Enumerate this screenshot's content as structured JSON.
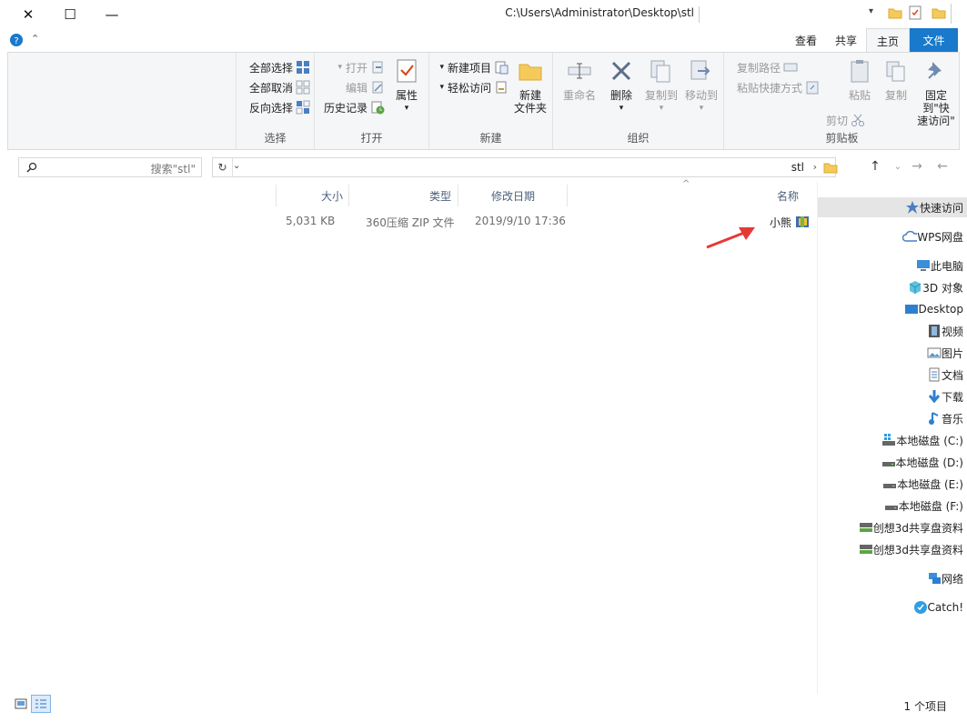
{
  "window": {
    "title": "C:\\Users\\Administrator\\Desktop\\stl",
    "minimize_glyph": "—",
    "maximize_glyph": "☐",
    "close_glyph": "✕"
  },
  "tabs": {
    "file": "文件",
    "home": "主页",
    "share": "共享",
    "view": "查看"
  },
  "ribbon": {
    "clipboard": {
      "label": "剪贴板",
      "pin_line1": "固定到\"快",
      "pin_line2": "速访问\"",
      "copy": "复制",
      "paste": "粘贴",
      "cut": "剪切",
      "copy_path": "复制路径",
      "paste_shortcut": "粘贴快捷方式"
    },
    "organize": {
      "label": "组织",
      "move_to": "移动到",
      "copy_to": "复制到",
      "delete": "删除",
      "rename": "重命名"
    },
    "new": {
      "label": "新建",
      "new_folder_line1": "新建",
      "new_folder_line2": "文件夹",
      "new_item": "新建项目",
      "easy_access": "轻松访问"
    },
    "open": {
      "label": "打开",
      "properties": "属性",
      "open": "打开",
      "edit": "编辑",
      "history": "历史记录"
    },
    "select": {
      "label": "选择",
      "select_all": "全部选择",
      "select_none": "全部取消",
      "invert": "反向选择"
    }
  },
  "address": {
    "path": "stl",
    "search_placeholder": "搜索\"stl\"",
    "refresh_glyph": "↻"
  },
  "columns": {
    "name": "名称",
    "date": "修改日期",
    "type": "类型",
    "size": "大小"
  },
  "files": [
    {
      "name": "小熊",
      "date": "2019/9/10 17:36",
      "type": "360压缩 ZIP 文件",
      "size": "5,031 KB"
    }
  ],
  "nav": {
    "quick_access": "快速访问",
    "wps": "WPS网盘",
    "this_pc": "此电脑",
    "obj3d": "3D 对象",
    "desktop": "Desktop",
    "videos": "视频",
    "pictures": "图片",
    "documents": "文档",
    "downloads": "下载",
    "music": "音乐",
    "drive_c": "本地磁盘 (C:)",
    "drive_d": "本地磁盘 (D:)",
    "drive_e": "本地磁盘 (E:)",
    "drive_f": "本地磁盘 (F:)",
    "share1": "创想3d共享盘资料",
    "share2": "创想3d共享盘资料",
    "network": "网络",
    "catch": "Catch!"
  },
  "status": {
    "count": "1 个项目"
  },
  "colors": {
    "accent": "#1979ca",
    "ribbon_bg": "#f5f6f7",
    "arrow": "#e53935",
    "selected_nav": "#e5e5e5"
  }
}
